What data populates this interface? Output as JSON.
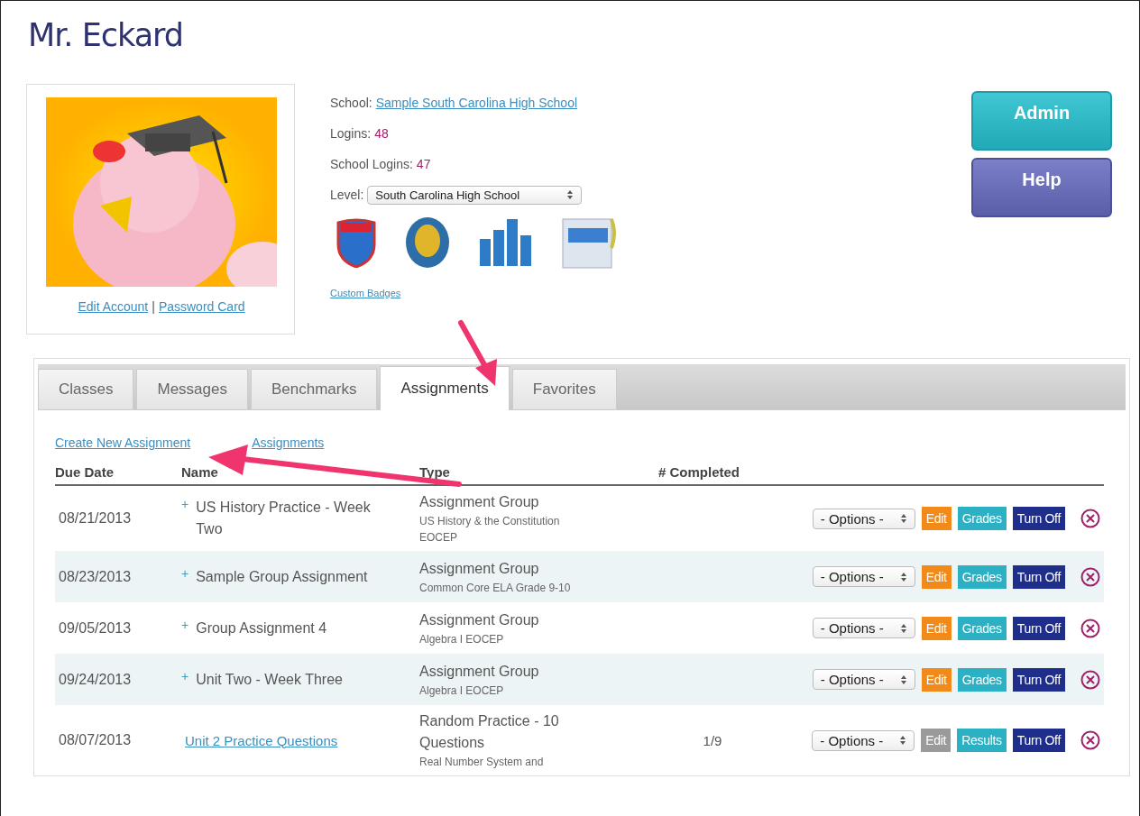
{
  "title": "Mr. Eckard",
  "profile": {
    "links": [
      "Edit Account",
      "Password Card"
    ],
    "separator": "|"
  },
  "info": {
    "school_label": "School:",
    "school": "Sample South Carolina High School",
    "logins_label": "Logins:",
    "logins": "48",
    "school_logins_label": "School Logins:",
    "school_logins": "47",
    "level_label": "Level:",
    "level": "South Carolina High School",
    "custom_badges": "Custom Badges"
  },
  "side_buttons": [
    {
      "label": "Admin",
      "kind": "admin"
    },
    {
      "label": "Help",
      "kind": "help"
    }
  ],
  "tabs": [
    {
      "label": "Classes",
      "selected": false
    },
    {
      "label": "Messages",
      "selected": false
    },
    {
      "label": "Benchmarks",
      "selected": false
    },
    {
      "label": "Assignments",
      "selected": true
    },
    {
      "label": "Favorites",
      "selected": false
    }
  ],
  "actions": [
    "Create New Assignment",
    "Assignments"
  ],
  "table": {
    "columns": [
      "Due Date",
      "Name",
      "Type",
      "# Completed"
    ],
    "rows": [
      {
        "due": "08/21/2013",
        "kind": "group",
        "expander": "+",
        "name": "US History Practice - Week Two",
        "type": "Assignment Group",
        "subject": "US History & the Constitution EOCEP",
        "completed": "",
        "options": "- Options -",
        "edit": "Edit",
        "edit_disabled": false,
        "report": "Grades",
        "turn_off": "Turn Off"
      },
      {
        "due": "08/23/2013",
        "kind": "group",
        "expander": "+",
        "name": "Sample Group Assignment",
        "type": "Assignment Group",
        "subject": "Common Core ELA Grade 9-10",
        "completed": "",
        "options": "- Options -",
        "edit": "Edit",
        "edit_disabled": false,
        "report": "Grades",
        "turn_off": "Turn Off"
      },
      {
        "due": "09/05/2013",
        "kind": "group",
        "expander": "+",
        "name": "Group Assignment 4",
        "type": "Assignment Group",
        "subject": "Algebra I EOCEP",
        "completed": "",
        "options": "- Options -",
        "edit": "Edit",
        "edit_disabled": false,
        "report": "Grades",
        "turn_off": "Turn Off"
      },
      {
        "due": "09/24/2013",
        "kind": "group",
        "expander": "+",
        "name": "Unit Two - Week Three",
        "type": "Assignment Group",
        "subject": "Algebra I EOCEP",
        "completed": "",
        "options": "- Options -",
        "edit": "Edit",
        "edit_disabled": false,
        "report": "Grades",
        "turn_off": "Turn Off"
      },
      {
        "due": "08/07/2013",
        "kind": "single",
        "name": "Unit 2 Practice Questions",
        "type": "Random Practice - 10 Questions",
        "subject": "Real Number System and",
        "completed": "1/9",
        "options": "- Options -",
        "edit": "Edit",
        "edit_disabled": true,
        "report": "Results",
        "turn_off": "Turn Off"
      }
    ]
  }
}
